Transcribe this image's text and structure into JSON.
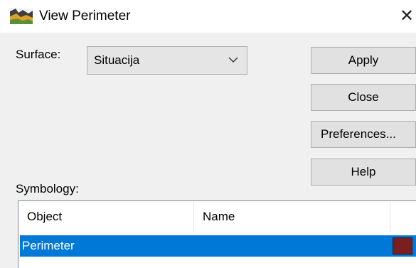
{
  "window": {
    "title": "View Perimeter",
    "close_glyph": "✕",
    "app_icon": "map-icon"
  },
  "surface": {
    "label": "Surface:",
    "value": "Situacija"
  },
  "buttons": {
    "apply": "Apply",
    "close": "Close",
    "preferences": "Preferences...",
    "help": "Help"
  },
  "symbology": {
    "label": "Symbology:",
    "columns": [
      "Object",
      "Name",
      ""
    ],
    "rows": [
      {
        "object": "Perimeter",
        "name": "",
        "color": "#7a1f1f",
        "selected": true
      }
    ]
  },
  "colors": {
    "selection": "#0078d7",
    "dialog_bg": "#f0f0f0",
    "button_bg": "#e1e1e1"
  }
}
